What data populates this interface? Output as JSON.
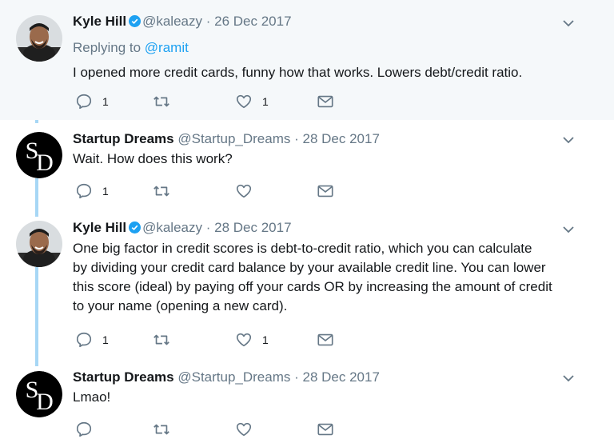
{
  "tweets": [
    {
      "name": "Kyle Hill",
      "handle": "@kaleazy",
      "separator": "·",
      "date": "26 Dec 2017",
      "replying_label": "Replying to",
      "replying_to": "@ramit",
      "lines": [
        "I opened more credit cards, funny how that works. Lowers debt/credit ratio."
      ],
      "reply_count": "1",
      "retweet_count": "",
      "like_count": "1",
      "verified": true,
      "avatar": "person-photo"
    },
    {
      "name": "Startup Dreams",
      "handle": "@Startup_Dreams",
      "separator": "·",
      "date": "28 Dec 2017",
      "lines": [
        "Wait. How does this work?"
      ],
      "reply_count": "1",
      "retweet_count": "",
      "like_count": "",
      "verified": false,
      "avatar": "sd-logo"
    },
    {
      "name": "Kyle Hill",
      "handle": "@kaleazy",
      "separator": "·",
      "date": "28 Dec 2017",
      "lines": [
        "One big factor in credit scores is debt-to-credit ratio, which you can calculate",
        "by dividing your credit card balance by your available credit line. You can lower",
        "this score (ideal) by paying off your cards OR by increasing the amount of credit",
        "to your name (opening a new card)."
      ],
      "reply_count": "1",
      "retweet_count": "",
      "like_count": "1",
      "verified": true,
      "avatar": "person-photo"
    },
    {
      "name": "Startup Dreams",
      "handle": "@Startup_Dreams",
      "separator": "·",
      "date": "28 Dec 2017",
      "lines": [
        "Lmao!"
      ],
      "reply_count": "",
      "retweet_count": "",
      "like_count": "",
      "verified": false,
      "avatar": "sd-logo"
    }
  ],
  "colors": {
    "highlight_bg": "#f5f8fa",
    "link": "#1da1f2",
    "muted": "#657786",
    "thread_line": "#a7d7f5"
  }
}
